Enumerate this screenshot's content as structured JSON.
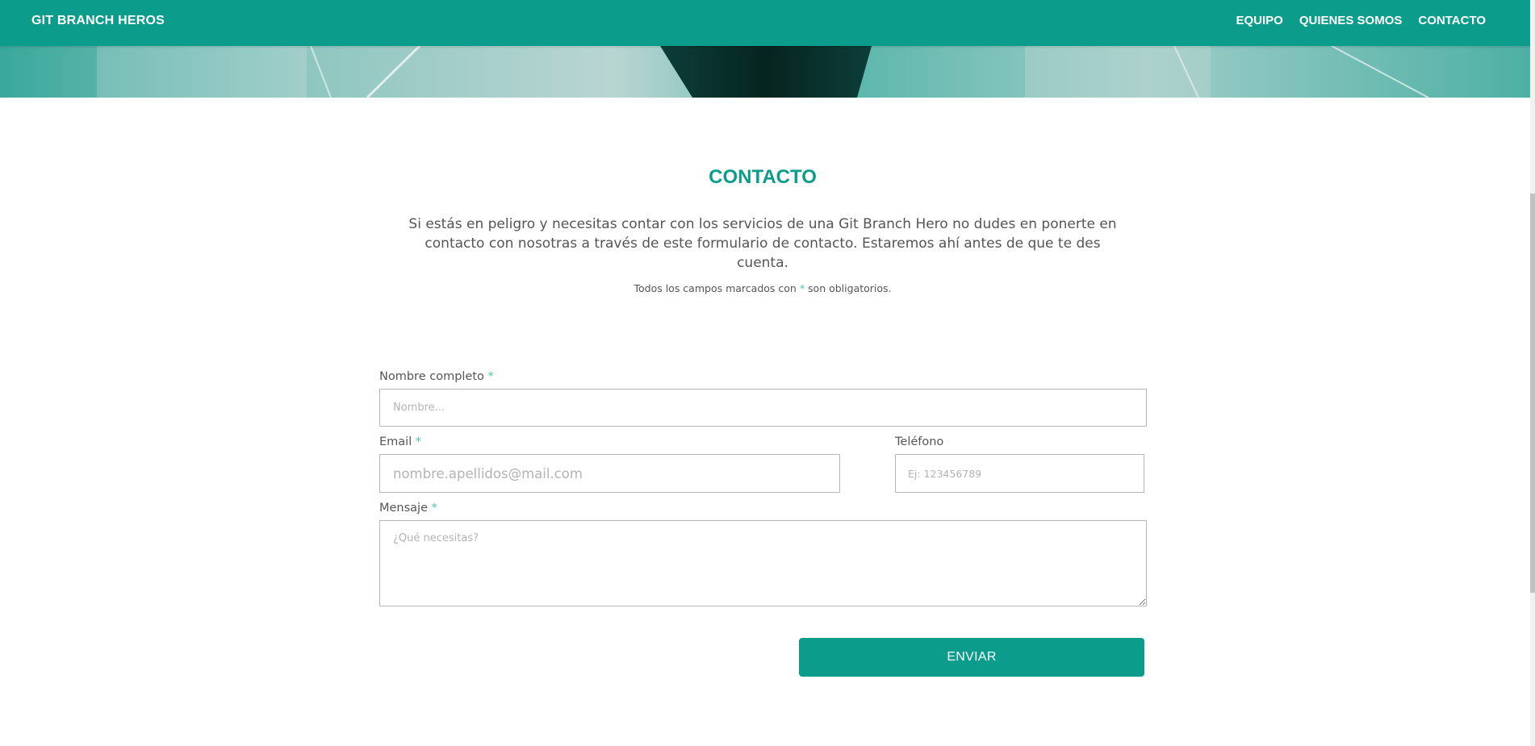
{
  "navbar": {
    "brand": "GIT BRANCH HEROS",
    "links": [
      {
        "label": "EQUIPO"
      },
      {
        "label": "QUIENES SOMOS"
      },
      {
        "label": "CONTACTO"
      }
    ]
  },
  "contact": {
    "title": "CONTACTO",
    "intro": "Si estás en peligro y necesitas contar con los servicios de una Git Branch Hero no dudes en ponerte en contacto con nosotras a través de este formulario de contacto. Estaremos ahí antes de que te des cuenta.",
    "required_note_prefix": "Todos los campos marcados con",
    "required_note_star": "*",
    "required_note_suffix": "son obligatorios."
  },
  "form": {
    "name": {
      "label": "Nombre completo",
      "required_mark": "*",
      "placeholder": "Nombre..."
    },
    "email": {
      "label": "Email",
      "required_mark": "*",
      "placeholder": "nombre.apellidos@mail.com"
    },
    "phone": {
      "label": "Teléfono",
      "placeholder": "Ej: 123456789"
    },
    "message": {
      "label": "Mensaje",
      "required_mark": "*",
      "placeholder": "¿Qué necesitas?"
    },
    "submit_label": "ENVIAR"
  },
  "colors": {
    "accent": "#0c9c8c",
    "required_star": "#4cc2b0"
  }
}
